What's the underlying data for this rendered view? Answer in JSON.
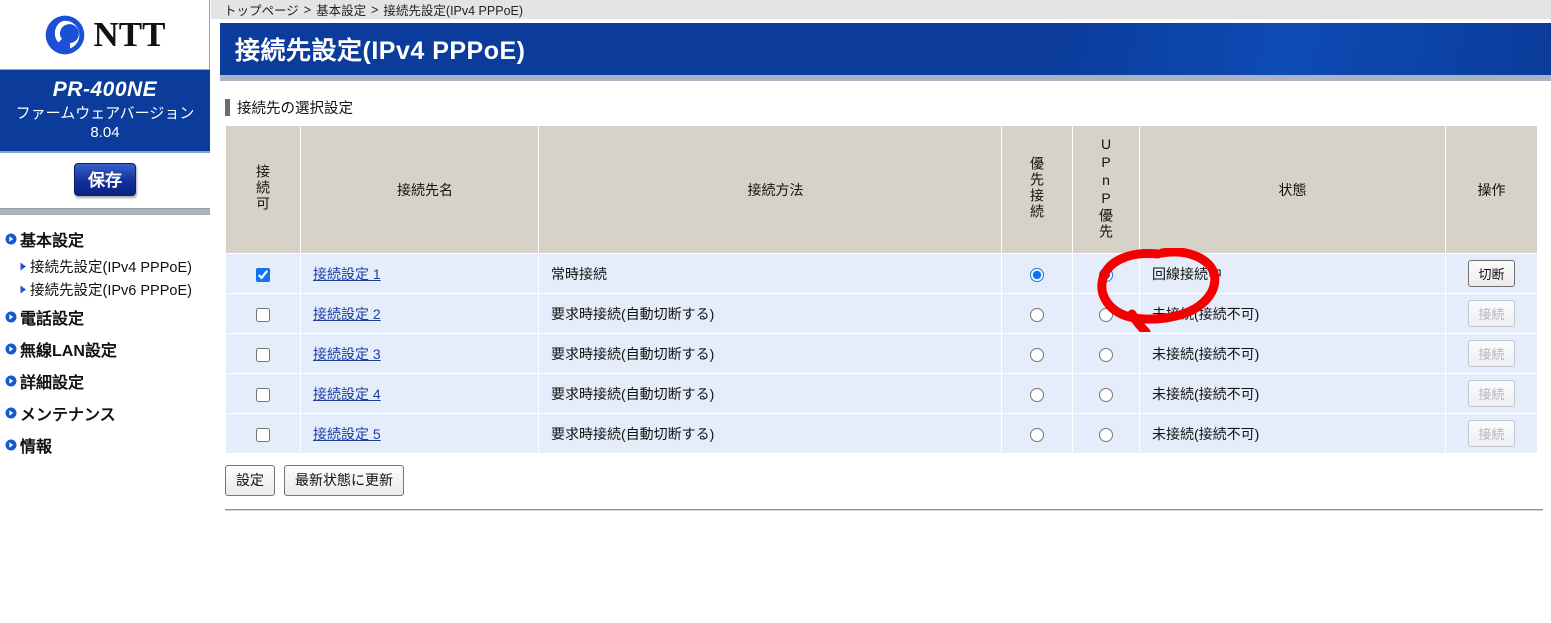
{
  "sidebar": {
    "logo": {
      "brand": "NTT",
      "mark_icon": "ntt-swirl-icon"
    },
    "model": {
      "name": "PR-400NE",
      "firmware_label": "ファームウェアバージョン",
      "firmware_version": "8.04"
    },
    "save_button": "保存",
    "items": [
      {
        "label": "基本設定",
        "icon": "chevron-circle-icon",
        "type": "group"
      },
      {
        "label": "接続先設定(IPv4 PPPoE)",
        "icon": "triangle-right-icon",
        "type": "sub"
      },
      {
        "label": "接続先設定(IPv6 PPPoE)",
        "icon": "triangle-right-icon",
        "type": "sub"
      },
      {
        "label": "電話設定",
        "icon": "chevron-circle-icon",
        "type": "group"
      },
      {
        "label": "無線LAN設定",
        "icon": "chevron-circle-icon",
        "type": "group"
      },
      {
        "label": "詳細設定",
        "icon": "chevron-circle-icon",
        "type": "group"
      },
      {
        "label": "メンテナンス",
        "icon": "chevron-circle-icon",
        "type": "group"
      },
      {
        "label": "情報",
        "icon": "chevron-circle-icon",
        "type": "group"
      }
    ]
  },
  "breadcrumb": {
    "items": [
      "トップページ",
      "基本設定",
      "接続先設定(IPv4 PPPoE)"
    ],
    "separator": ">"
  },
  "page": {
    "title": "接続先設定(IPv4 PPPoE)",
    "section_title": "接続先の選択設定"
  },
  "table": {
    "headers": {
      "enabled": "接続可",
      "name": "接続先名",
      "method": "接続方法",
      "priority": "優先接続",
      "upnp": "UPnP優先",
      "status": "状態",
      "operation": "操作"
    },
    "rows": [
      {
        "enabled": true,
        "name": "接続設定 1",
        "method": "常時接続",
        "priority": true,
        "upnp": true,
        "status": "回線接続中",
        "op_label": "切断",
        "op_disabled": false,
        "annotated": true
      },
      {
        "enabled": false,
        "name": "接続設定 2",
        "method": "要求時接続(自動切断する)",
        "priority": false,
        "upnp": false,
        "status": "未接続(接続不可)",
        "op_label": "接続",
        "op_disabled": true,
        "annotated": false
      },
      {
        "enabled": false,
        "name": "接続設定 3",
        "method": "要求時接続(自動切断する)",
        "priority": false,
        "upnp": false,
        "status": "未接続(接続不可)",
        "op_label": "接続",
        "op_disabled": true,
        "annotated": false
      },
      {
        "enabled": false,
        "name": "接続設定 4",
        "method": "要求時接続(自動切断する)",
        "priority": false,
        "upnp": false,
        "status": "未接続(接続不可)",
        "op_label": "接続",
        "op_disabled": true,
        "annotated": false
      },
      {
        "enabled": false,
        "name": "接続設定 5",
        "method": "要求時接続(自動切断する)",
        "priority": false,
        "upnp": false,
        "status": "未接続(接続不可)",
        "op_label": "接続",
        "op_disabled": true,
        "annotated": false
      }
    ]
  },
  "footer": {
    "apply_label": "設定",
    "refresh_label": "最新状態に更新"
  },
  "annotation": {
    "shape": "red-ellipse-highlight",
    "color": "#f40000",
    "target": "回線接続中"
  },
  "colors": {
    "brand_blue": "#0b3c9b",
    "header_beige": "#d6d2c8",
    "row_blue": "#e5edfb",
    "link_blue": "#1a3fa0",
    "annotation_red": "#f40000"
  }
}
